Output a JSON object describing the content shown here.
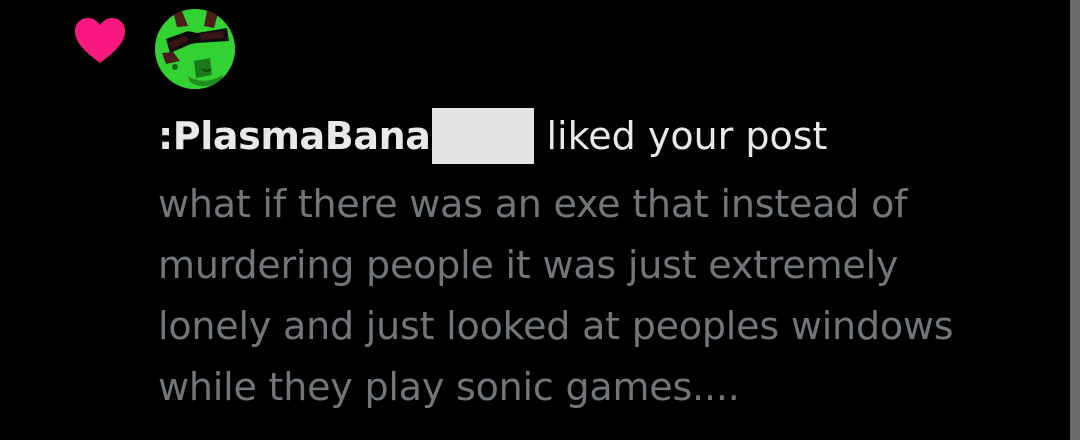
{
  "notification": {
    "type_icon": "heart-icon",
    "accent_color": "#f91880",
    "avatar": "green-avatar-with-sunglasses",
    "username": ":PlasmaBana",
    "action": "liked your post",
    "post_lines": [
      "what if there was an exe that instead of",
      "murdering people it was just extremely",
      "lonely and just looked at peoples windows",
      "while they play sonic games...."
    ]
  }
}
